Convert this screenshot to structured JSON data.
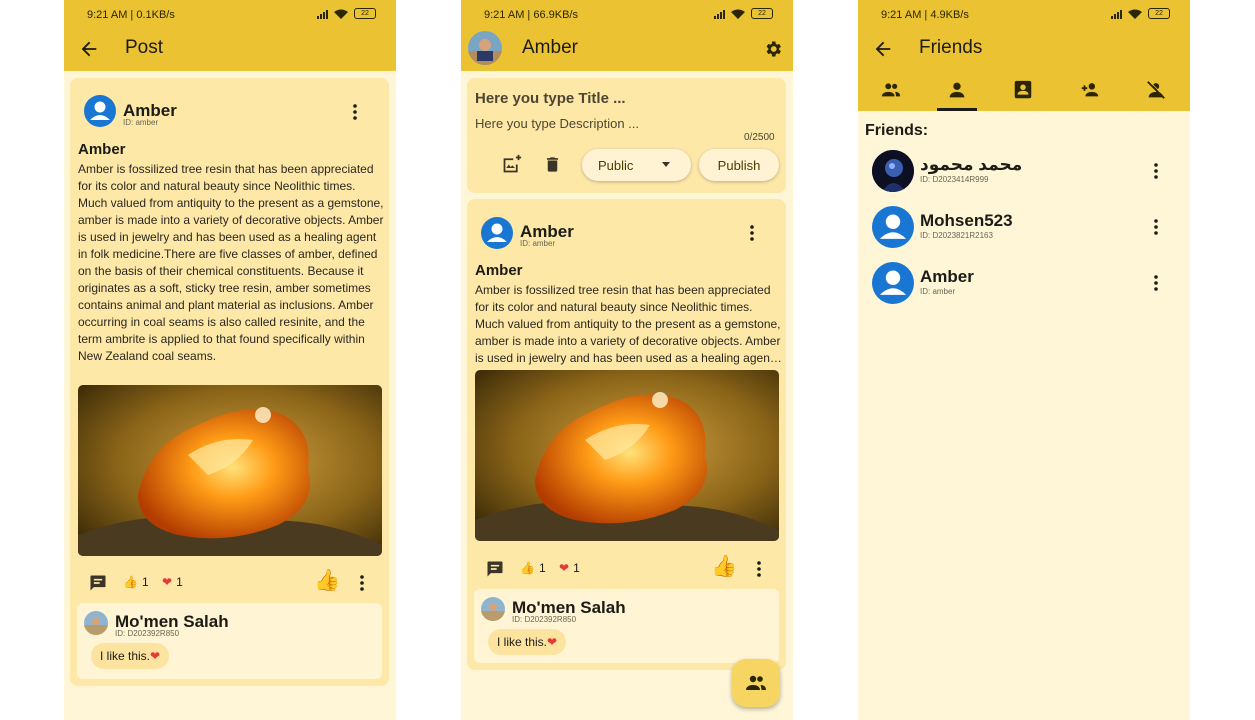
{
  "status": {
    "screen1": "9:21 AM | 0.1KB/s",
    "screen2": "9:21 AM | 66.9KB/s",
    "screen3": "9:21 AM | 4.9KB/s",
    "battery": "22"
  },
  "colors": {
    "appbar": "#ebc231",
    "background": "#fff6d8",
    "card": "#fde8a8",
    "avatar": "#1976d2",
    "heart": "#e53935"
  },
  "post_screen": {
    "title": "Post",
    "author": {
      "name": "Amber",
      "id": "ID: amber"
    },
    "post_title": "Amber",
    "post_body": "Amber is fossilized tree resin that has been appreciated for its color and natural beauty since Neolithic times. Much valued from antiquity to the present as a gemstone, amber is made into a variety of decorative objects. Amber is used in jewelry and has been used as a healing agent in folk medicine.There are five classes of amber, defined on the basis of their chemical constituents. Because it originates as a soft, sticky tree resin, amber sometimes contains animal and plant material as inclusions. Amber occurring in coal seams is also called resinite, and the term ambrite is applied to that found specifically within New Zealand coal seams.",
    "like_count": "1",
    "love_count": "1",
    "comment": {
      "name": "Mo'men Salah",
      "id": "ID: D202392R850",
      "text": "I like this."
    }
  },
  "profile_screen": {
    "title": "Amber",
    "title_placeholder": "Here you type Title ...",
    "desc_placeholder": "Here you type Description ...",
    "counter": "0/2500",
    "visibility": "Public",
    "publish": "Publish",
    "author": {
      "name": "Amber",
      "id": "ID: amber"
    },
    "post_title": "Amber",
    "post_body": "Amber is fossilized tree resin that has been appreciated for its color and natural beauty since Neolithic times. Much valued from antiquity to the present as a gemstone, amber is made into a variety of decorative objects. Amber is used in jewelry and has been used as a healing agent in folk medicine.",
    "like_count": "1",
    "love_count": "1",
    "comment": {
      "name": "Mo'men Salah",
      "id": "ID: D202392R850",
      "text": "I like this."
    }
  },
  "friends_screen": {
    "title": "Friends",
    "tabs": [
      "friends-tab",
      "person-tab",
      "contacts-tab",
      "add-friend-tab",
      "blocked-tab"
    ],
    "section": "Friends:",
    "friends": [
      {
        "name": "محمد محمود",
        "id": "ID: D2023414R999"
      },
      {
        "name": "Mohsen523",
        "id": "ID: D2023821R2163"
      },
      {
        "name": "Amber",
        "id": "ID: amber"
      }
    ]
  }
}
